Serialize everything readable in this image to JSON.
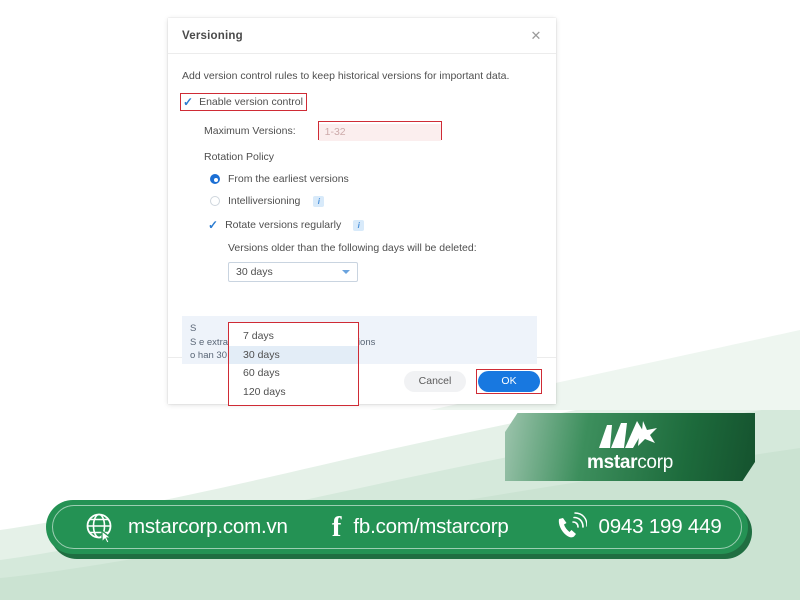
{
  "dialog": {
    "title": "Versioning",
    "close_icon": "close-icon",
    "description": "Add version control rules to keep historical versions for important data.",
    "enable_checkbox": {
      "label": "Enable version control",
      "checked": true
    },
    "maximum_versions": {
      "label": "Maximum Versions:",
      "value": "",
      "placeholder": "1-32"
    },
    "rotation_policy_label": "Rotation Policy",
    "radios": [
      {
        "label": "From the earliest versions",
        "selected": true,
        "info": false
      },
      {
        "label": "Intelliversioning",
        "selected": false,
        "info": true
      }
    ],
    "rotate_checkbox": {
      "label": "Rotate versions regularly",
      "checked": true,
      "info": true
    },
    "days_label": "Versions older than the following days will be deleted:",
    "select": {
      "value": "30 days",
      "caret_icon": "chevron-down-icon",
      "options": [
        "7 days",
        "30 days",
        "60 days",
        "120 days"
      ],
      "selected_option": "30 days",
      "open": true
    },
    "info_panel": {
      "line1": "S",
      "line2": "S                                       e extra versions when exceeding versions",
      "line3": "o                                      han 30 days.",
      "visible_tail_1": "e extra versions when exceeding versions",
      "visible_tail_2": "han",
      "visible_bold": "30",
      "visible_tail_3": "days."
    },
    "footer": {
      "cancel_label": "Cancel",
      "ok_label": "OK"
    }
  },
  "branding": {
    "logo_text_bold": "mstar",
    "logo_text_light": "corp",
    "logo_icon": "mstar-logo-icon"
  },
  "contact": {
    "website": {
      "icon": "globe-icon",
      "text": "mstarcorp.com.vn"
    },
    "facebook": {
      "icon": "facebook-icon",
      "text": "fb.com/mstarcorp"
    },
    "phone": {
      "icon": "phone-icon",
      "text": "0943 199 449"
    }
  },
  "colors": {
    "accent_blue": "#1878e0",
    "annotation_red": "#cf2b35",
    "brand_green": "#249254",
    "info_panel_bg": "#eef3fa"
  }
}
